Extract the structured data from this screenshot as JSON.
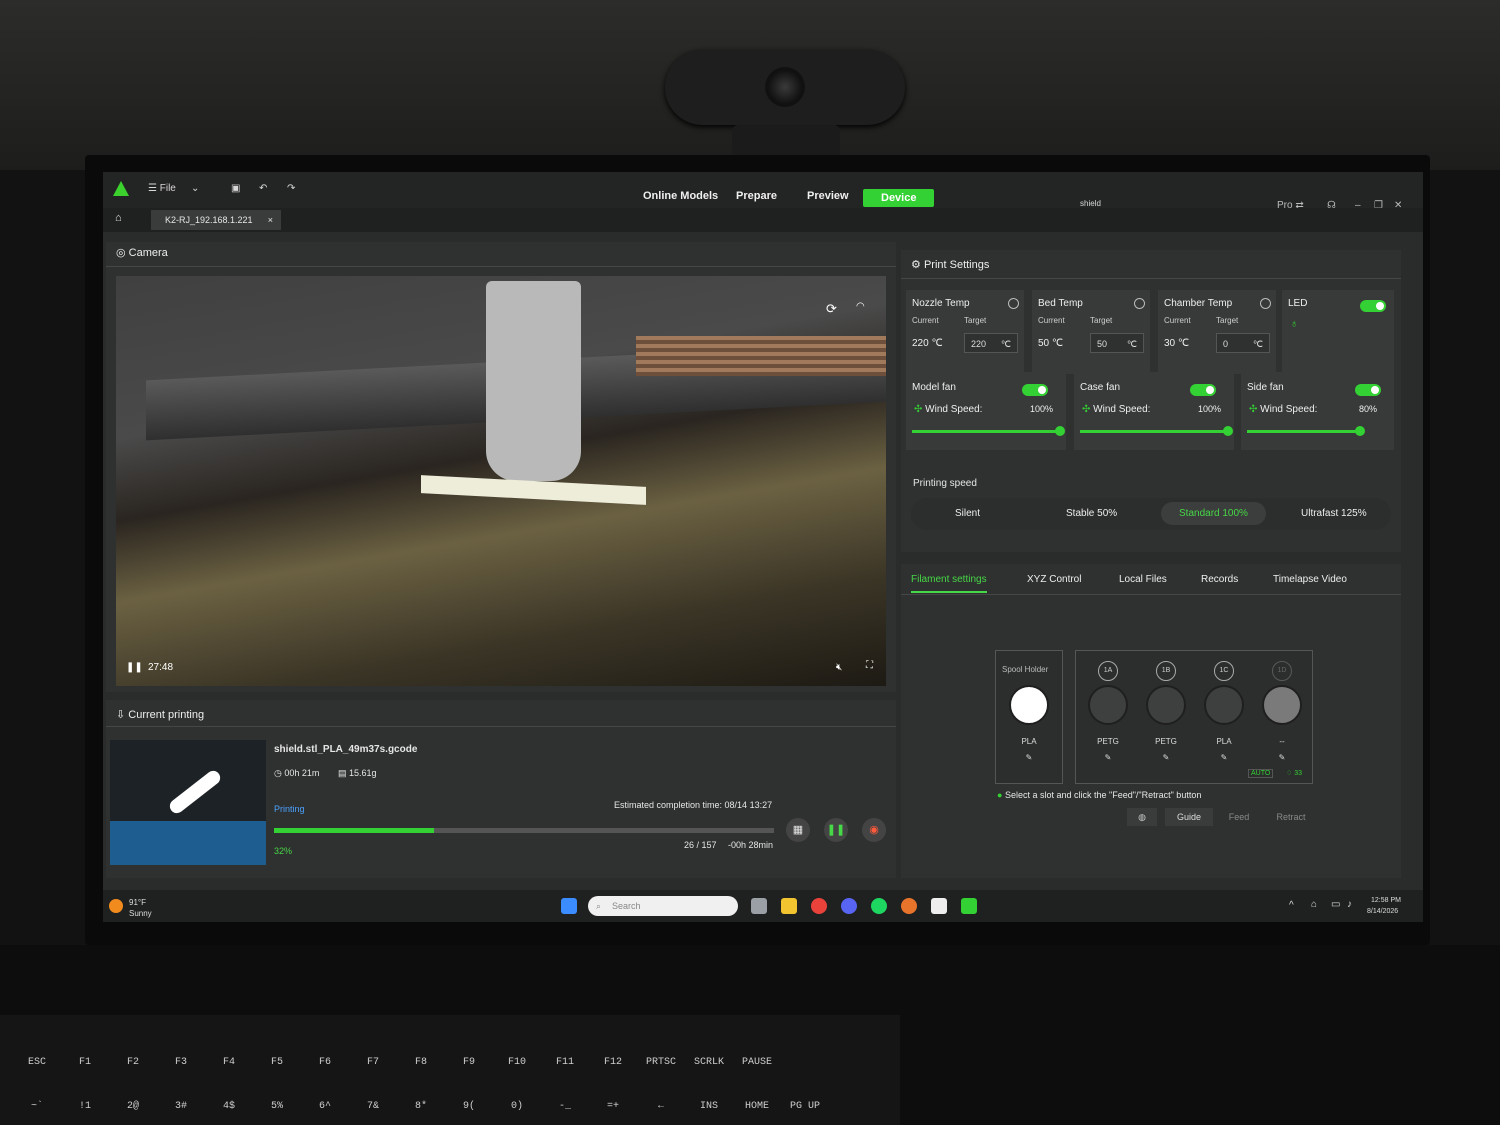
{
  "app": {
    "menu_file": "File",
    "nav": [
      "Online Models",
      "Prepare",
      "Preview",
      "Device"
    ],
    "filename": "shield",
    "pro_label": "Pro ⇄",
    "device_tab": "K2-RJ_192.168.1.221"
  },
  "camera": {
    "title": "Camera",
    "time": "27:48"
  },
  "current": {
    "title": "Current printing",
    "file": "shield.stl_PLA_49m37s.gcode",
    "duration": "00h 21m",
    "weight": "15.61g",
    "status": "Printing",
    "eta": "Estimated completion time: 08/14 13:27",
    "progress_pct": 32,
    "progress_label": "32%",
    "layers": "26 / 157",
    "remaining": "-00h 28min"
  },
  "settings": {
    "title": "Print Settings",
    "current_label": "Current",
    "target_label": "Target",
    "nozzle": {
      "title": "Nozzle Temp",
      "current": "220 ℃",
      "target": "220",
      "unit": "℃"
    },
    "bed": {
      "title": "Bed Temp",
      "current": "50 ℃",
      "target": "50",
      "unit": "℃"
    },
    "chamber": {
      "title": "Chamber Temp",
      "current": "30 ℃",
      "target": "0",
      "unit": "℃"
    },
    "led": "LED",
    "wind_label": "Wind Speed:",
    "fans": [
      {
        "name": "Model fan",
        "speed": "100%",
        "level": 100
      },
      {
        "name": "Case fan",
        "speed": "100%",
        "level": 100
      },
      {
        "name": "Side fan",
        "speed": "80%",
        "level": 80
      }
    ],
    "speed_title": "Printing speed",
    "speeds": [
      "Silent",
      "Stable 50%",
      "Standard 100%",
      "Ultrafast 125%"
    ],
    "active_speed": 2
  },
  "tabs": [
    "Filament settings",
    "XYZ Control",
    "Local Files",
    "Records",
    "Timelapse Video"
  ],
  "filament": {
    "spool_title": "Spool Holder",
    "spool_material": "PLA",
    "slots": [
      {
        "id": "1A",
        "material": "PETG"
      },
      {
        "id": "1B",
        "material": "PETG"
      },
      {
        "id": "1C",
        "material": "PLA"
      },
      {
        "id": "1D",
        "material": "--"
      }
    ],
    "auto": "AUTO",
    "humidity": "33",
    "hint": "Select a slot and click the \"Feed\"/\"Retract\" button",
    "guide": "Guide",
    "feed": "Feed",
    "retract": "Retract"
  },
  "taskbar": {
    "temp": "91°F",
    "weather": "Sunny",
    "search_placeholder": "Search",
    "time": "12:58 PM",
    "date": "8/14/2026"
  },
  "keyboard": {
    "row1": [
      "ESC",
      "F1",
      "F2",
      "F3",
      "F4",
      "F5",
      "F6",
      "F7",
      "F8",
      "F9",
      "F10",
      "F11",
      "F12",
      "PRTSC",
      "SCRLK",
      "PAUSE"
    ],
    "row2": [
      "~`",
      "!1",
      "2@",
      "3#",
      "4$",
      "5%",
      "6^",
      "7&",
      "8*",
      "9(",
      "0)",
      "-_",
      "=+",
      "←",
      "INS",
      "HOME",
      "PG UP"
    ]
  },
  "colors": {
    "accent": "#33d133",
    "panel": "#2f3030",
    "background": "#2a2b2b"
  }
}
